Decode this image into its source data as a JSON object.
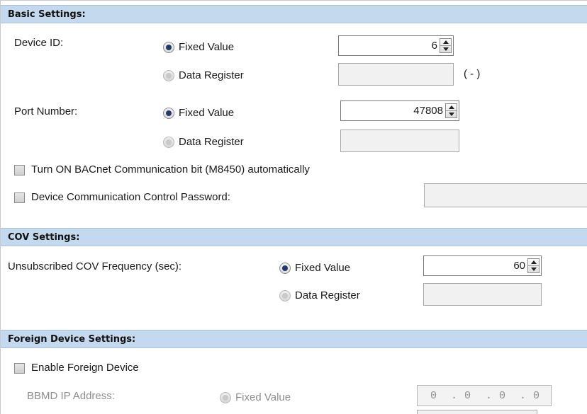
{
  "basic": {
    "header": "Basic Settings:",
    "device_id": {
      "label": "Device ID:",
      "fixed_label": "Fixed Value",
      "register_label": "Data Register",
      "value": "6",
      "unit": "( - )"
    },
    "port_number": {
      "label": "Port Number:",
      "fixed_label": "Fixed Value",
      "register_label": "Data Register",
      "value": "47808"
    },
    "auto_bit_label": "Turn ON BACnet Communication bit (M8450) automatically",
    "password_label": "Device Communication Control Password:"
  },
  "cov": {
    "header": "COV Settings:",
    "frequency": {
      "label": "Unsubscribed COV Frequency (sec):",
      "fixed_label": "Fixed Value",
      "register_label": "Data Register",
      "value": "60"
    }
  },
  "foreign": {
    "header": "Foreign Device Settings:",
    "enable_label": "Enable Foreign Device",
    "bbmd": {
      "label": "BBMD IP Address:",
      "fixed_label": "Fixed Value",
      "ip": [
        "0",
        "0",
        "0",
        "0"
      ]
    }
  },
  "colors": {
    "section_header": "#c5d9ee",
    "radio_selected": "#233a6b",
    "disabled_text": "#8e8e8e"
  }
}
